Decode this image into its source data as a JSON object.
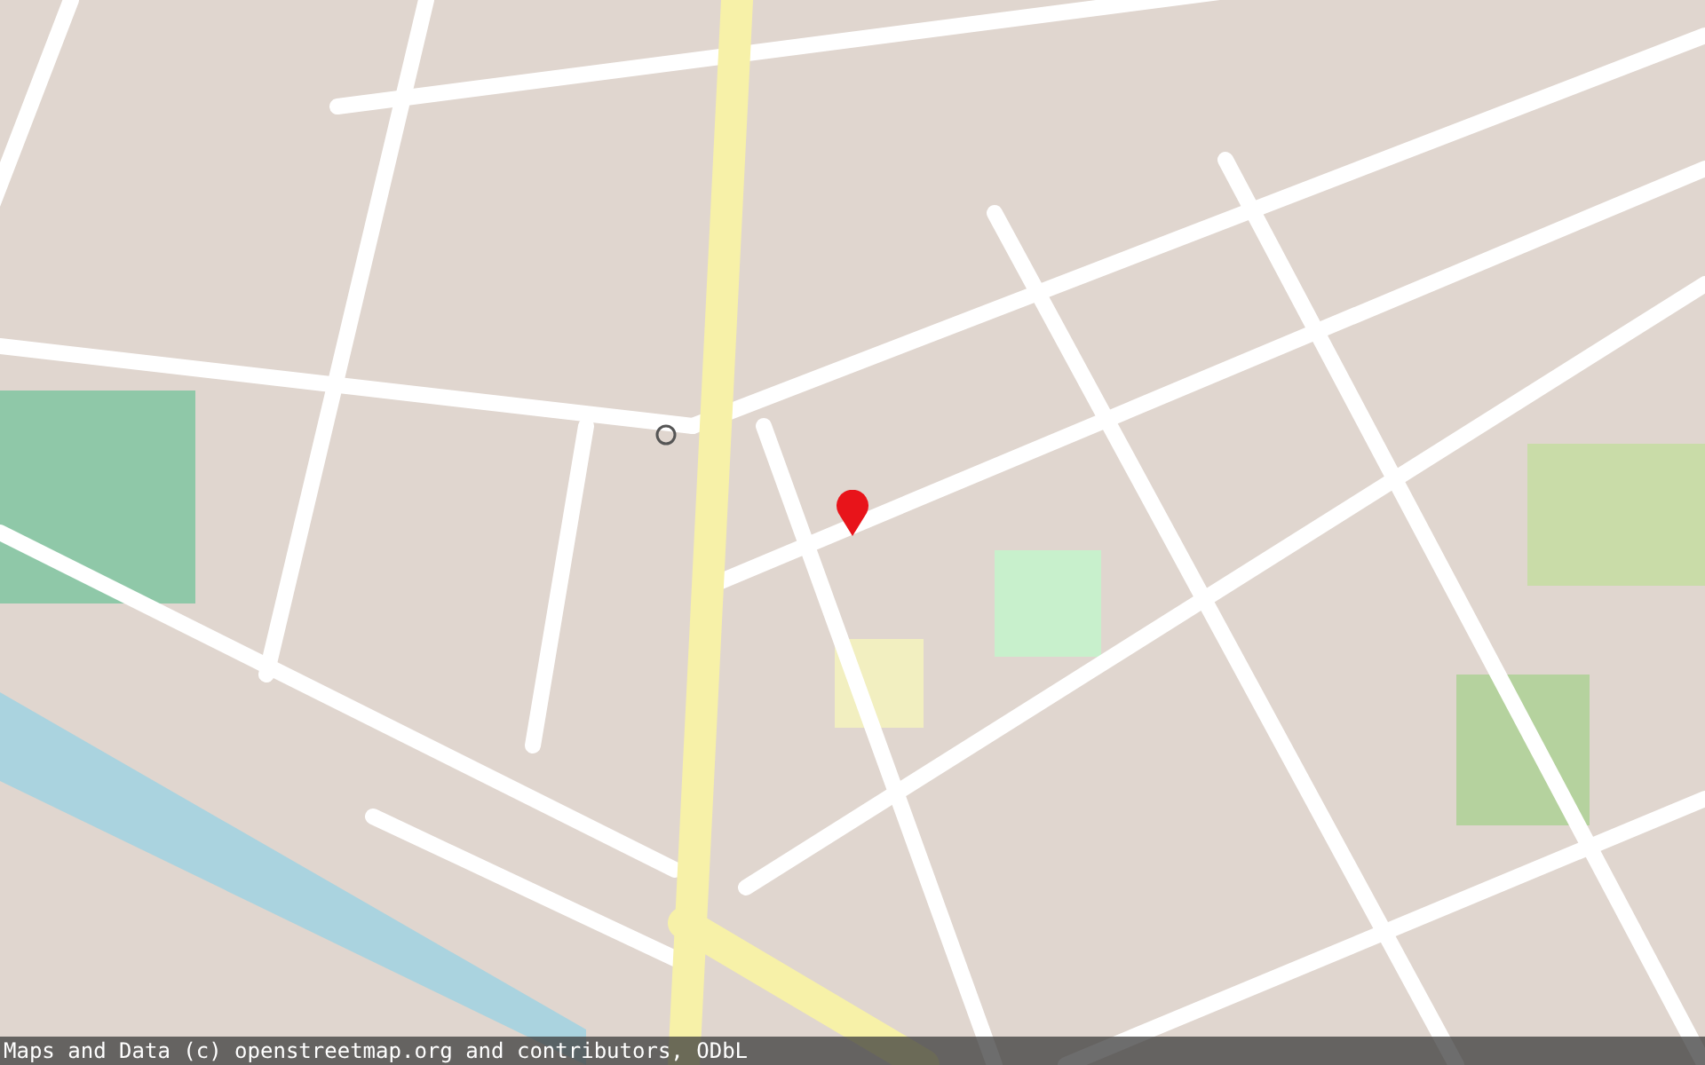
{
  "attribution": "Maps and Data (c) openstreetmap.org and contributors, ODbL"
}
